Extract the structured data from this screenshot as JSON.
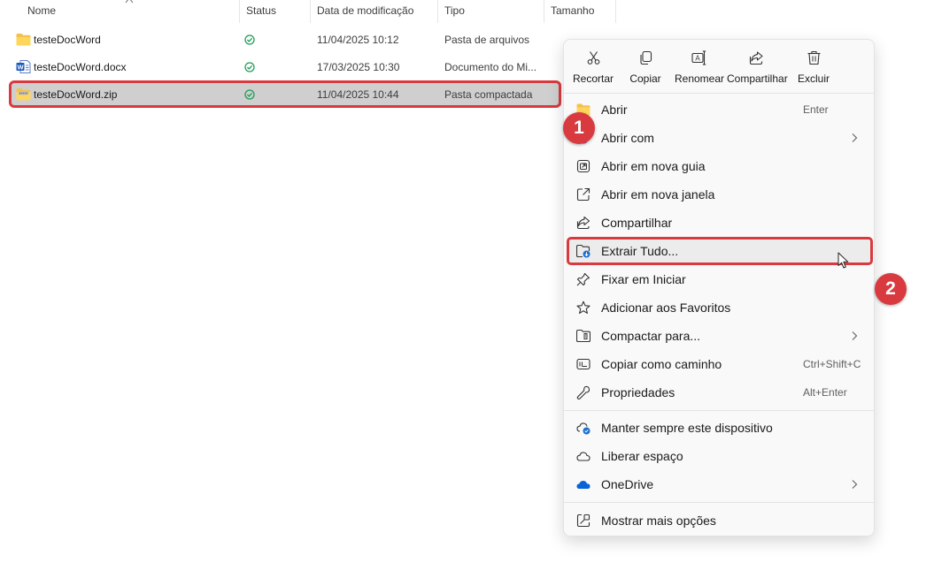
{
  "columns": {
    "name": "Nome",
    "status": "Status",
    "modified": "Data de modificação",
    "type": "Tipo",
    "size": "Tamanho"
  },
  "files": [
    {
      "name": "testeDocWord",
      "icon": "folder-icon",
      "status": "synced",
      "modified": "11/04/2025 10:12",
      "type": "Pasta de arquivos"
    },
    {
      "name": "testeDocWord.docx",
      "icon": "word-document-icon",
      "status": "synced",
      "modified": "17/03/2025 10:30",
      "type": "Documento do Mi..."
    },
    {
      "name": "testeDocWord.zip",
      "icon": "zip-folder-icon",
      "status": "synced",
      "modified": "11/04/2025 10:44",
      "type": "Pasta compactada",
      "selected": true
    }
  ],
  "badges": {
    "step1": "1",
    "step2": "2"
  },
  "menu": {
    "quick_actions": [
      {
        "label": "Recortar",
        "icon": "scissors-icon"
      },
      {
        "label": "Copiar",
        "icon": "copy-icon"
      },
      {
        "label": "Renomear",
        "icon": "rename-icon"
      },
      {
        "label": "Compartilhar",
        "icon": "share-icon"
      },
      {
        "label": "Excluir",
        "icon": "trash-icon"
      }
    ],
    "items": [
      {
        "label": "Abrir",
        "shortcut": "Enter",
        "icon": "folder-open-icon"
      },
      {
        "label": "Abrir com",
        "icon": "open-with-icon",
        "submenu": true
      },
      {
        "label": "Abrir em nova guia",
        "icon": "new-tab-icon"
      },
      {
        "label": "Abrir em nova janela",
        "icon": "new-window-icon"
      },
      {
        "label": "Compartilhar",
        "icon": "share-icon"
      },
      {
        "label": "Extrair Tudo...",
        "icon": "extract-icon",
        "highlighted": true
      },
      {
        "label": "Fixar em Iniciar",
        "icon": "pin-icon"
      },
      {
        "label": "Adicionar aos Favoritos",
        "icon": "star-icon"
      },
      {
        "label": "Compactar para...",
        "icon": "compress-icon",
        "submenu": true
      },
      {
        "label": "Copiar como caminho",
        "shortcut": "Ctrl+Shift+C",
        "icon": "copy-path-icon"
      },
      {
        "label": "Propriedades",
        "shortcut": "Alt+Enter",
        "icon": "wrench-icon"
      }
    ],
    "onedrive_items": [
      {
        "label": "Manter sempre este dispositivo",
        "icon": "cloud-keep-icon"
      },
      {
        "label": "Liberar espaço",
        "icon": "cloud-outline-icon"
      },
      {
        "label": "OneDrive",
        "icon": "onedrive-icon",
        "submenu": true
      }
    ],
    "more_options": {
      "label": "Mostrar mais opções",
      "icon": "more-options-icon"
    }
  },
  "colors": {
    "highlight_red": "#d93a3f",
    "selected_row": "#cfcfcf",
    "folder_yellow": "#f4c24a",
    "status_green": "#1f9d55",
    "onedrive_blue": "#0a64d6"
  }
}
